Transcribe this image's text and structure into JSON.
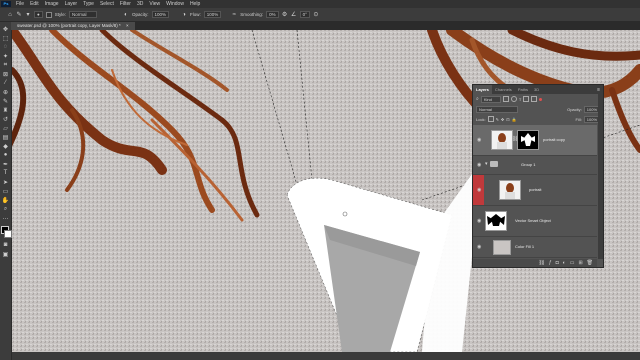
{
  "app": {
    "logo": "Ps"
  },
  "menu": [
    "File",
    "Edit",
    "Image",
    "Layer",
    "Type",
    "Select",
    "Filter",
    "3D",
    "View",
    "Window",
    "Help"
  ],
  "options_bar": {
    "style_label": "Style:",
    "style_value": "Normal",
    "opacity_label": "Opacity:",
    "opacity_value": "100%",
    "flow_label": "Flow:",
    "flow_value": "100%",
    "smoothing_label": "Smoothing:",
    "smoothing_value": "0%",
    "angle_value": "0°"
  },
  "document_tab": {
    "title": "sweater.psd @ 100% (portrait copy, Layer Mask/8) *"
  },
  "layers_panel": {
    "tabs": [
      "Layers",
      "Channels",
      "Paths",
      "3D"
    ],
    "active_tab": "Layers",
    "filter_value": "Kind",
    "blend_mode": "Normal",
    "opacity_label": "Opacity:",
    "opacity_value": "100%",
    "lock_label": "Lock:",
    "fill_label": "Fill:",
    "fill_value": "100%",
    "layers": [
      {
        "name": "portrait copy",
        "selected": true,
        "kind": "masked"
      },
      {
        "name": "Group 1",
        "selected": false,
        "kind": "group"
      },
      {
        "name": "portrait",
        "selected": false,
        "kind": "pixel"
      },
      {
        "name": "Vector Smart Object",
        "selected": false,
        "kind": "smart"
      },
      {
        "name": "Color Fill 1",
        "selected": false,
        "kind": "fill"
      }
    ]
  },
  "colors": {
    "ui_dark": "#323232",
    "panel": "#535353",
    "selected_layer": "#6a6a6a",
    "accent_red": "#c0393b",
    "sweater": "#c8c4c2",
    "hair": "#8a3f1a"
  }
}
